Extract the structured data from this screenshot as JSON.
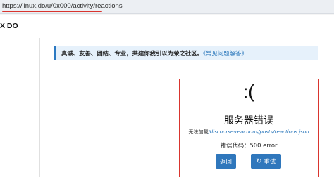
{
  "browser": {
    "url": "https://linux.do/u/0x000/activity/reactions"
  },
  "header": {
    "site_title": "X DO"
  },
  "banner": {
    "text": "真诚、友善、团结、专业，共建你我引以为荣之社区。",
    "link": "《常见问题解答》"
  },
  "error": {
    "face": ":(",
    "title": "服务器错误",
    "description_prefix": "无法加载",
    "description_path": "/discourse-reactions/posts/reactions.json",
    "code": "错误代码：500 error",
    "back_label": "返回",
    "retry_label": "重试"
  },
  "colors": {
    "accent": "#2f77bc",
    "highlight_red": "#d9352e",
    "banner_bg": "#e6f1fb"
  },
  "icons": {
    "retry": "refresh-icon"
  }
}
